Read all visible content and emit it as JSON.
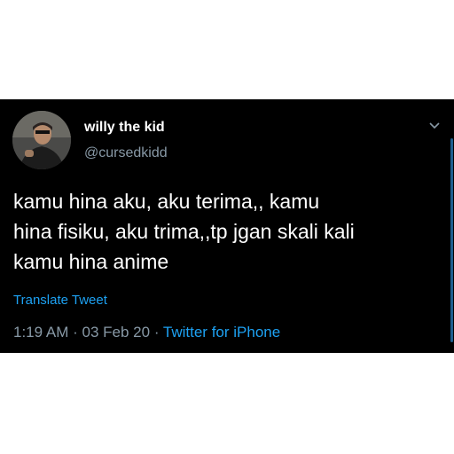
{
  "tweet": {
    "author": {
      "display_name": "willy the kid",
      "handle": "@cursedkidd",
      "avatar_icon": "profile-photo"
    },
    "text": "kamu hina aku, aku terima,, kamu\nhina fisiku, aku trima,,tp jgan skali kali\nkamu hina anime",
    "translate_label": "Translate Tweet",
    "time": "1:19 AM",
    "separator": "·",
    "date": "03 Feb 20",
    "source": "Twitter for iPhone",
    "menu_icon": "chevron-down-icon"
  },
  "colors": {
    "background": "#000000",
    "text": "#ffffff",
    "secondary": "#8899a6",
    "accent": "#1da1f2"
  }
}
